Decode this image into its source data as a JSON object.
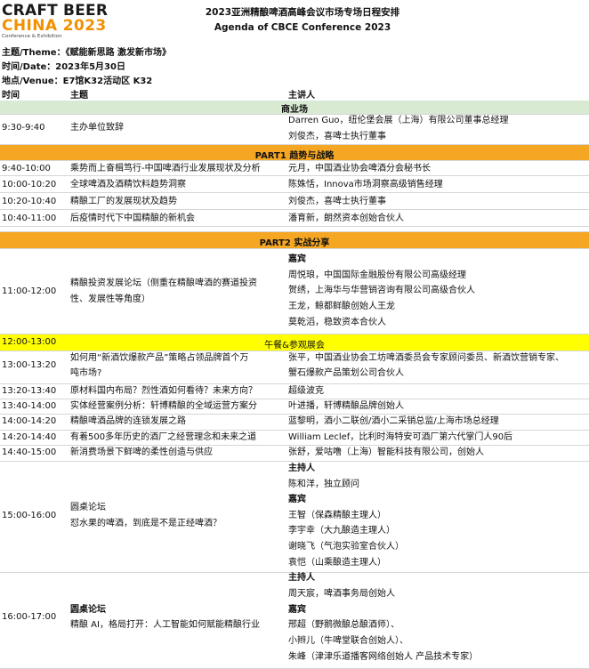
{
  "logo": {
    "line1": "CRAFT BEER",
    "line2": "CHINA 2023",
    "line3": "Conference & Exhibition"
  },
  "header": {
    "title_cn": "2023亚洲精酿啤酒高峰会议市场专场日程安排",
    "title_en": "Agenda of CBCE Conference 2023"
  },
  "meta": {
    "theme": "主题/Theme：《赋能新思路 激发新市场》",
    "date": "时间/Date：2023年5月30日",
    "venue": "地点/Venue：E7馆K32活动区 K32"
  },
  "columns": {
    "time": "时间",
    "topic": "主题",
    "speaker": "主讲人"
  },
  "sections": {
    "business": "商业场",
    "part1": "PART1 趋势与战略",
    "part2": "PART2 实战分享",
    "lunch": "午餐&参观展会"
  },
  "rows": {
    "r1": {
      "time": "9:30-9:40",
      "topic": "主办单位致辞",
      "speakers": [
        "Darren Guo，纽伦堡会展（上海）有限公司董事总经理",
        "刘俊杰，喜啤士执行董事"
      ]
    },
    "r2": {
      "time": "9:40-10:00",
      "topic": "乘势而上奋楫笃行-中国啤酒行业发展现状及分析",
      "speaker": "元月，中国酒业协会啤酒分会秘书长"
    },
    "r3": {
      "time": "10:00-10:20",
      "topic": "全球啤酒及酒精饮料趋势洞察",
      "speaker": "陈姝恬，Innova市场洞察高级销售经理"
    },
    "r4": {
      "time": "10:20-10:40",
      "topic": "精酿工厂的发展现状及趋势",
      "speaker": "刘俊杰，喜啤士执行董事"
    },
    "r5": {
      "time": "10:40-11:00",
      "topic": "后疫情时代下中国精酿的新机会",
      "speaker": "潘育新，朗然资本创始合伙人"
    },
    "r6": {
      "time": "11:00-12:00",
      "topic": [
        "精酿投资发展论坛（侧重在精酿啤酒的赛道投资",
        "性、发展性等角度）"
      ],
      "guest_label": "嘉宾",
      "speakers": [
        "周悦琅，中国国际金融股份有限公司高级经理",
        "贺绣，上海华与华营销咨询有限公司高级合伙人",
        "王龙，鲸都鲜酿创始人王龙",
        "莫乾滔，稳致资本合伙人"
      ]
    },
    "r7": {
      "time": "12:00-13:00"
    },
    "r8": {
      "time": "13:00-13:20",
      "topic": [
        "如何用“新酒饮爆款产品”策略占领品牌首个万",
        "吨市场?"
      ],
      "speakers": [
        "张平，中国酒业协会工坊啤酒委员会专家顾问委员、新酒饮营销专家、",
        "蟹石爆款产品策划公司合伙人"
      ]
    },
    "r9": {
      "time": "13:20-13:40",
      "topic": "原材料国内布局？烈性酒如何看待？未来方向？",
      "speaker": "超级波克"
    },
    "r10": {
      "time": "13:40-14:00",
      "topic": "实体经营案例分析：轩博精酿的全域运营方案分",
      "speaker": "叶进播，轩博精酿品牌创始人"
    },
    "r11": {
      "time": "14:00-14:20",
      "topic": "精酿啤酒品牌的连锁发展之路",
      "speaker": "蓝黎明，酒小二联创/酒小二采销总监/上海市场总经理"
    },
    "r12": {
      "time": "14:20-14:40",
      "topic": "有着500多年历史的酒厂之经营理念和未来之道",
      "speaker": "William Leclef，比利时海特安可酒厂第六代掌门人90后"
    },
    "r13": {
      "time": "14:40-15:00",
      "topic": "新消费场景下鲜啤的柔性创造与供应",
      "speaker": "张舒，爱咕噜（上海）智能科技有限公司，创始人"
    },
    "r14": {
      "time": "15:00-16:00",
      "topic": [
        "圆桌论坛",
        "怼水果的啤酒，到底是不是正经啤酒？"
      ],
      "host_label": "主持人",
      "host": "陈和洋，独立顾问",
      "guest_label": "嘉宾",
      "guests": [
        "王智（保森精酿主理人）",
        "李宇幸（大九酿造主理人）",
        "谢晓飞（气泡实验室合伙人）",
        "袁恺（山乘酿造主理人）"
      ]
    },
    "r15": {
      "time": "16:00-17:00",
      "topic": [
        "圆桌论坛",
        "精酿 AI，格局打开：人工智能如何赋能精酿行业"
      ],
      "host_label": "主持人",
      "host": "周天宸，啤酒事务局创始人",
      "guest_label": "嘉宾",
      "guests": [
        "邢超（野鹅微酿总酿酒师）、",
        "小辫儿（牛啤堂联合创始人）、",
        "朱峰（津津乐道播客网络创始人 产品技术专家）"
      ]
    }
  },
  "colors": {
    "section_header_bg": "#d9ead3",
    "part_bg": "#f5a623",
    "lunch_bg": "#ffff00",
    "logo_orange": "#f29100"
  }
}
